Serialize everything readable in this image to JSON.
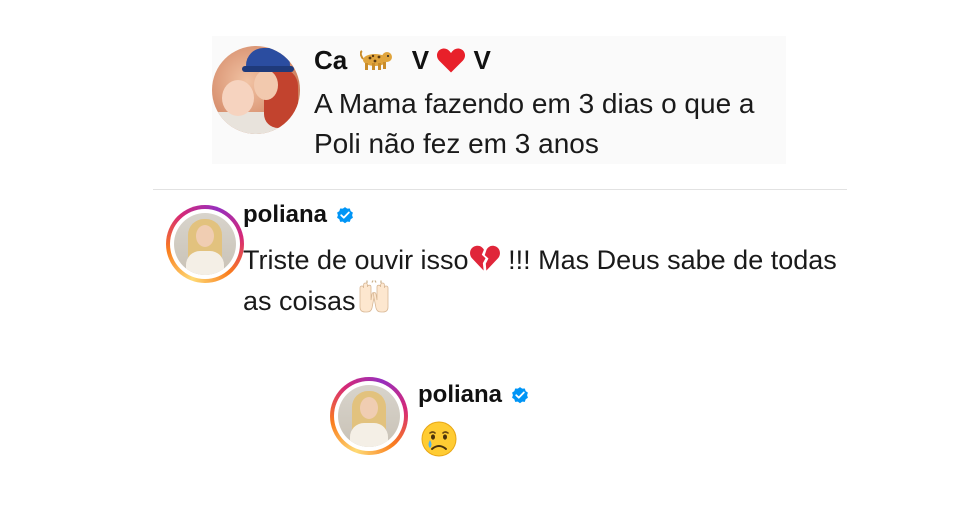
{
  "comments": [
    {
      "username_parts": [
        "Ca",
        "V",
        "V"
      ],
      "username_emojis": [
        "leopard-emoji",
        "red-heart-emoji"
      ],
      "text": "A Mama fazendo em 3 dias o que a Poli não fez em 3 anos"
    },
    {
      "username": "poliana",
      "verified": true,
      "text_before": "Triste de ouvir isso",
      "emoji_1": "broken-heart-emoji",
      "text_middle": " !!! Mas Deus sabe de todas as coisas",
      "emoji_2": "raising-hands-emoji"
    },
    {
      "username": "poliana",
      "verified": true,
      "emoji": "crying-face-emoji"
    }
  ],
  "colors": {
    "verified_blue": "#0095f6",
    "broken_heart": "#e0263a",
    "red_heart": "#e8202a",
    "story_ring": [
      "#feda75",
      "#fa7e1e",
      "#d62976",
      "#962fbf"
    ]
  }
}
